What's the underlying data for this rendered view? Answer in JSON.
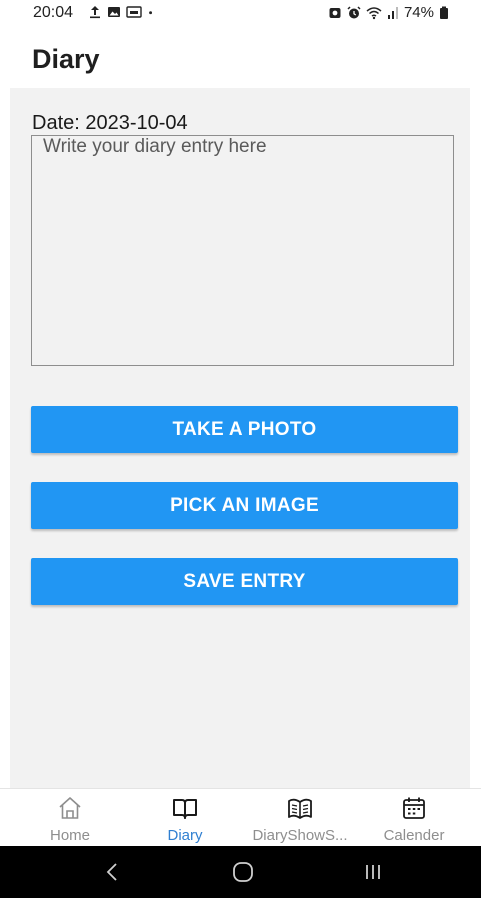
{
  "status_bar": {
    "time": "20:04",
    "battery_percent": "74%",
    "icons_left": [
      "upload-icon",
      "gallery-icon",
      "image-notification-icon",
      "dot-icon"
    ],
    "icons_right": [
      "alarm-icon",
      "alarm-clock-icon",
      "wifi-icon",
      "signal-icon",
      "battery-icon"
    ]
  },
  "header": {
    "title": "Diary"
  },
  "main": {
    "date_label": "Date: 2023-10-04",
    "entry_placeholder": "Write your diary entry here",
    "entry_value": "",
    "buttons": {
      "take_photo": "TAKE A PHOTO",
      "pick_image": "PICK AN IMAGE",
      "save_entry": "SAVE ENTRY"
    }
  },
  "tabs": [
    {
      "label": "Home",
      "icon": "home-icon",
      "active": false
    },
    {
      "label": "Diary",
      "icon": "open-book-icon",
      "active": true
    },
    {
      "label": "DiaryShowS...",
      "icon": "book-pages-icon",
      "active": false
    },
    {
      "label": "Calender",
      "icon": "calendar-icon",
      "active": false
    }
  ],
  "nav_bar": {
    "icons": [
      "back-icon",
      "home-circle-icon",
      "recent-apps-icon"
    ]
  },
  "colors": {
    "accent": "#2196f3",
    "active_tab": "#2f7fd1",
    "inactive_tab": "#8e8e8e",
    "content_bg": "#f2f2f2"
  }
}
